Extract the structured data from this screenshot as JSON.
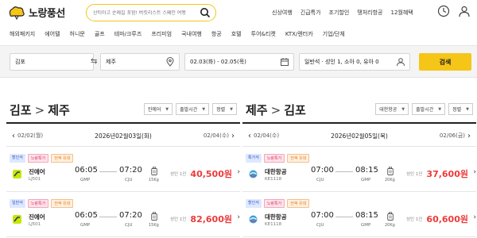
{
  "brand": {
    "name": "노랑풍선",
    "accent": "#f5c518",
    "price_color": "#ee3a3a"
  },
  "header": {
    "search_placeholder": "산티아고 순례길 포함! 버킷리스트 스페인 여행",
    "top_links": [
      "신상여행",
      "긴급특가",
      "조기할인",
      "땡처리항공",
      "12월혜택"
    ],
    "icons": [
      "clock-icon",
      "user-icon"
    ]
  },
  "nav": [
    "해외패키지",
    "에어텔",
    "허니문",
    "골프",
    "테마/크루즈",
    "프리미엄",
    "국내여행",
    "항공",
    "호텔",
    "투어&티켓",
    "KTX/렌터카",
    "기업/단체"
  ],
  "search_bar": {
    "from": "김포",
    "to": "제주",
    "dates": "02.03(화) - 02.05(목)",
    "passengers": "일반석 · 성인 1, 소아 0, 유아 0",
    "button": "검색"
  },
  "columns": [
    {
      "origin": "김포",
      "destination": "제주",
      "filters": [
        "진에어",
        "출발시간",
        "정렬"
      ],
      "prev_date": "02/02(월)",
      "current_date": "2026년02월03일(화)",
      "next_date": "02/04(수)",
      "flights": [
        {
          "badges": [
            "할인석",
            "노랑특가",
            "전액 유대"
          ],
          "airline": "진에어",
          "flight_no": "LJ501",
          "dep_time": "06:05",
          "dep_airport": "GMP",
          "arr_time": "07:20",
          "arr_airport": "CJU",
          "baggage": "15Kg",
          "pax": "성인 1인",
          "price": "40,500원"
        },
        {
          "badges": [
            "일반석",
            "노랑특가",
            "전액 유대"
          ],
          "airline": "진에어",
          "flight_no": "LJ501",
          "dep_time": "06:05",
          "dep_airport": "GMP",
          "arr_time": "07:20",
          "arr_airport": "CJU",
          "baggage": "15Kg",
          "pax": "성인 1인",
          "price": "82,600원"
        }
      ]
    },
    {
      "origin": "제주",
      "destination": "김포",
      "filters": [
        "대한항공",
        "출발시간",
        "정렬"
      ],
      "prev_date": "02/04(수)",
      "current_date": "2026년02월05일(목)",
      "next_date": "02/06(금)",
      "flights": [
        {
          "badges": [
            "특가석",
            "노랑특가",
            "전액 유대"
          ],
          "airline": "대한항공",
          "flight_no": "KE1118",
          "dep_time": "07:00",
          "dep_airport": "CJU",
          "arr_time": "08:15",
          "arr_airport": "GMP",
          "baggage": "20Kg",
          "pax": "성인 1인",
          "price": "37,600원"
        },
        {
          "badges": [
            "할인석",
            "노랑특가",
            "전액 유대"
          ],
          "airline": "대한항공",
          "flight_no": "KE1118",
          "dep_time": "07:00",
          "dep_airport": "CJU",
          "arr_time": "08:15",
          "arr_airport": "GMP",
          "baggage": "20Kg",
          "pax": "성인 1인",
          "price": "60,600원"
        }
      ]
    }
  ]
}
